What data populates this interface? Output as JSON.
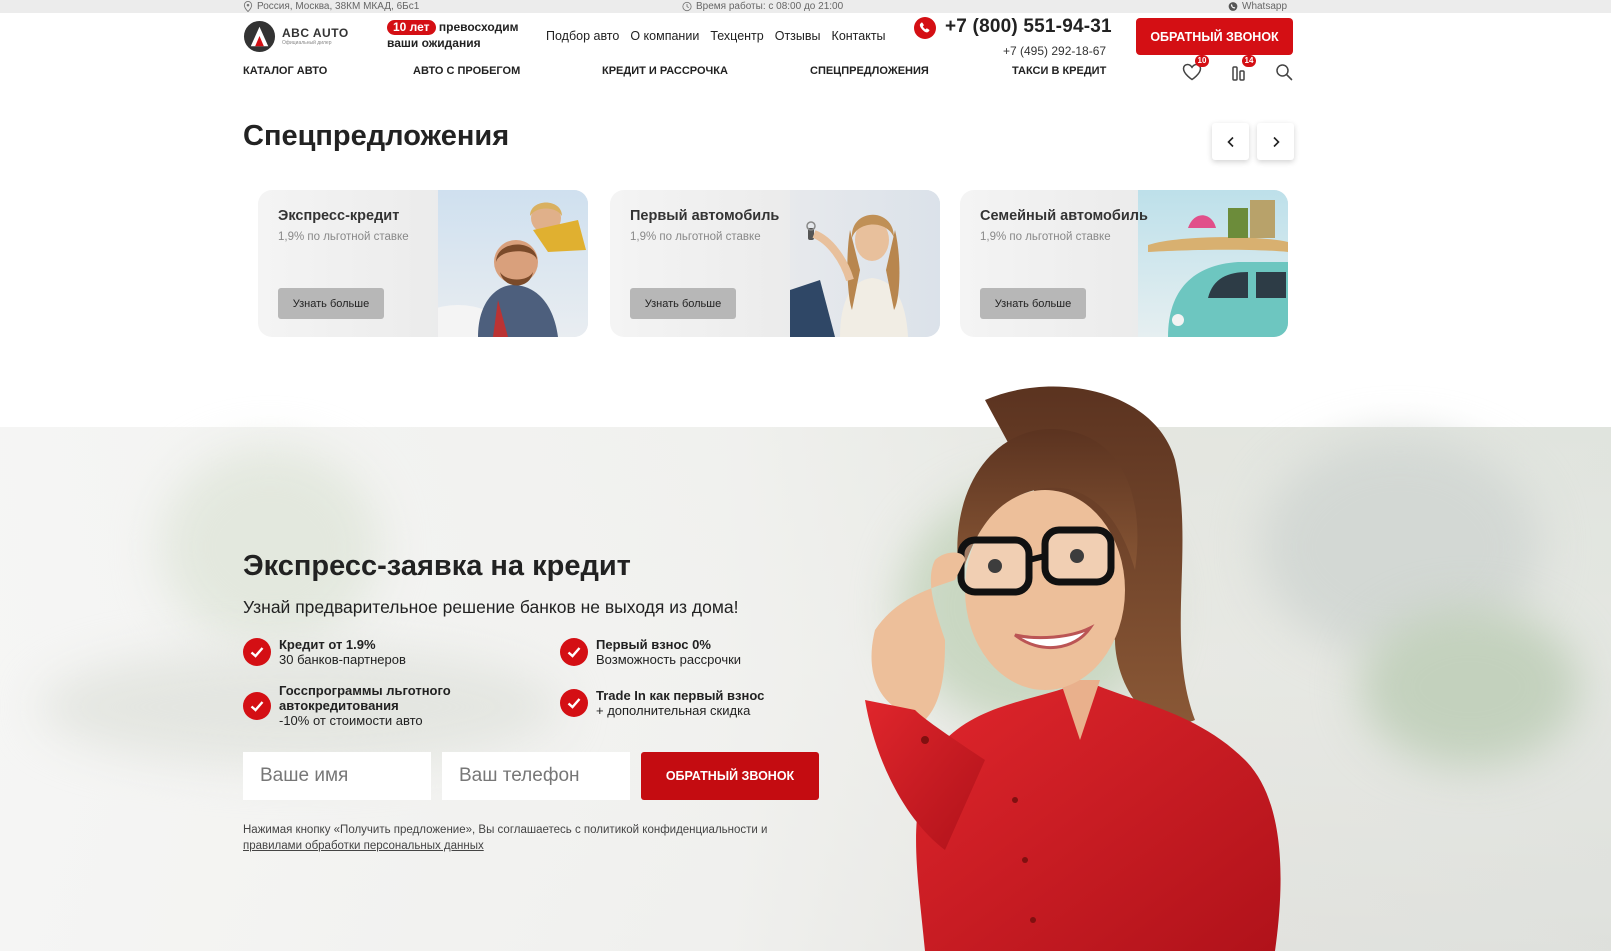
{
  "topbar": {
    "address": "Россия, Москва, 38КМ МКАД, 6Бс1",
    "hours": "Время работы: с 08:00 до 21:00",
    "whatsapp": "Whatsapp"
  },
  "header": {
    "logo_name": "ABC AUTO",
    "logo_sub": "Официальный дилер",
    "years_badge": "10 лет",
    "years_text": "превосходим ваши ожидания",
    "top_links": [
      "Подбор авто",
      "О компании",
      "Техцентр",
      "Отзывы",
      "Контакты"
    ],
    "phone_main": "+7 (800) 551-94-31",
    "phone_sub": "+7 (495) 292-18-67",
    "callback_label": "ОБРАТНЫЙ ЗВОНОК",
    "main_nav": [
      "КАТАЛОГ АВТО",
      "АВТО С ПРОБЕГОМ",
      "КРЕДИТ И РАССРОЧКА",
      "СПЕЦПРЕДЛОЖЕНИЯ",
      "ТАКСИ В КРЕДИТ"
    ],
    "favorites_count": "10",
    "compare_count": "14"
  },
  "specials": {
    "title": "Спецпредложения",
    "cards": [
      {
        "title": "Экспресс-кредит",
        "subtitle": "1,9% по льготной ставке",
        "button": "Узнать больше"
      },
      {
        "title": "Первый автомобиль",
        "subtitle": "1,9% по льготной ставке",
        "button": "Узнать больше"
      },
      {
        "title": "Семейный автомобиль",
        "subtitle": "1,9% по льготной ставке",
        "button": "Узнать больше"
      }
    ]
  },
  "credit": {
    "title": "Экспресс-заявка на кредит",
    "subtitle": "Узнай предварительное решение банков не выходя из дома!",
    "features": [
      {
        "bold": "Кредит от 1.9%",
        "text": "30 банков-партнеров"
      },
      {
        "bold": "Первый взнос 0%",
        "text": "Возможность рассрочки"
      },
      {
        "bold": "Госспрограммы льготного автокредитования",
        "text": "-10% от стоимости авто"
      },
      {
        "bold": "Trade In как первый взнос",
        "text": "+ дополнительная скидка"
      }
    ],
    "name_placeholder": "Ваше имя",
    "phone_placeholder": "Ваш телефон",
    "button": "ОБРАТНЫЙ ЗВОНОК",
    "disclaimer": "Нажимая кнопку «Получить предложение», Вы соглашаетесь с политикой конфиденциальности и",
    "disclaimer_link": "правилами обработки персональных данных"
  },
  "colors": {
    "accent": "#d40f14",
    "card_button": "#b7b7b7",
    "topbar_bg": "#ececec"
  }
}
